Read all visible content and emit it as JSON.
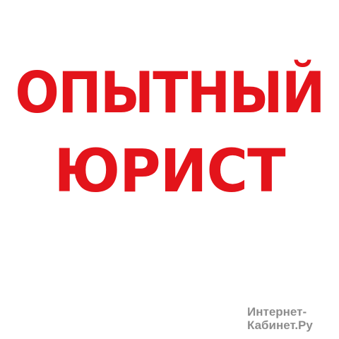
{
  "headline": {
    "line1": "ОПЫТНЫЙ",
    "line2": "ЮРИСТ",
    "color": "#e3141b"
  },
  "watermark": {
    "line1": "Интернет-",
    "line2": "Кабинет.Ру"
  }
}
